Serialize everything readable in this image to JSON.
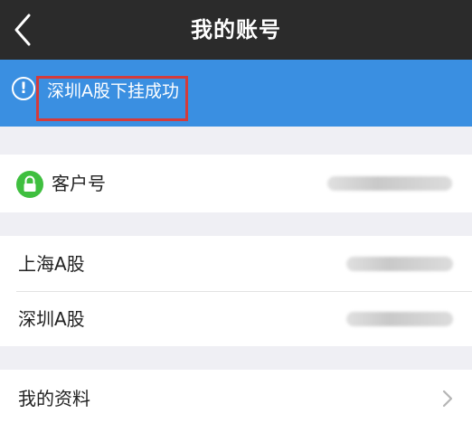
{
  "nav": {
    "back_icon": "chevron-left-icon",
    "title": "我的账号"
  },
  "notice": {
    "icon": "exclamation-circle-icon",
    "message": "深圳A股下挂成功",
    "background": "#3a8fe1",
    "highlight_color": "#d43b3b"
  },
  "account": {
    "icon": "lock-icon",
    "label": "客户号"
  },
  "holdings": {
    "items": [
      {
        "label": "上海A股"
      },
      {
        "label": "深圳A股"
      }
    ]
  },
  "profile": {
    "label": "我的资料",
    "icon": "chevron-right-icon"
  }
}
